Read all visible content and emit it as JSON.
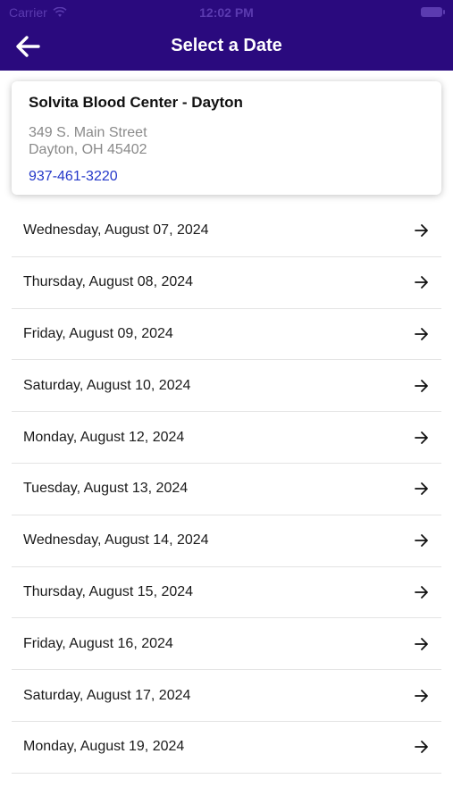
{
  "status_bar": {
    "carrier": "Carrier",
    "time": "12:02 PM"
  },
  "header": {
    "title": "Select a Date",
    "background_color": "#2a0a7e"
  },
  "center": {
    "name": "Solvita Blood Center - Dayton",
    "address_line1": "349 S. Main Street",
    "address_line2": "Dayton, OH 45402",
    "phone": "937-461-3220"
  },
  "dates": [
    "Wednesday, August 07, 2024",
    "Thursday, August 08, 2024",
    "Friday, August 09, 2024",
    "Saturday, August 10, 2024",
    "Monday, August 12, 2024",
    "Tuesday, August 13, 2024",
    "Wednesday, August 14, 2024",
    "Thursday, August 15, 2024",
    "Friday, August 16, 2024",
    "Saturday, August 17, 2024",
    "Monday, August 19, 2024"
  ],
  "icons": {
    "back": "back-arrow-icon",
    "row": "arrow-right-icon"
  }
}
